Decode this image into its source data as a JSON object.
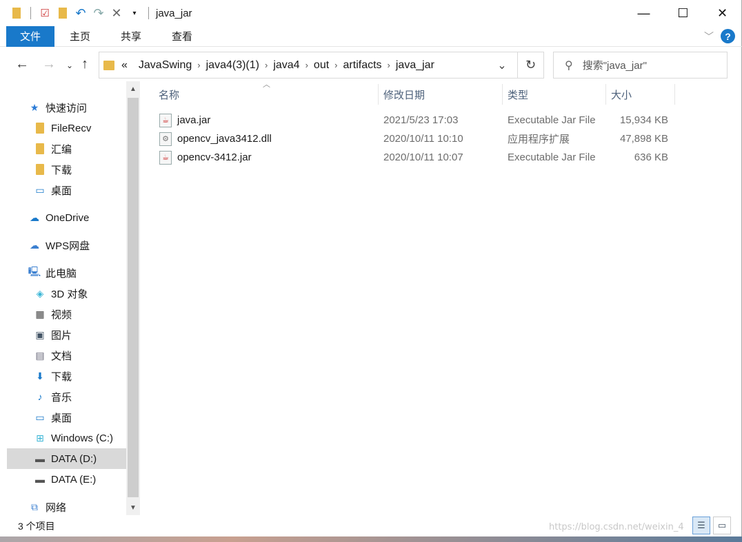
{
  "window": {
    "title": "java_jar"
  },
  "ribbon": {
    "tabs": [
      "文件",
      "主页",
      "共享",
      "查看"
    ],
    "help": "?"
  },
  "address": {
    "overflow": "«",
    "crumbs": [
      "JavaSwing",
      "java4(3)(1)",
      "java4",
      "out",
      "artifacts",
      "java_jar"
    ]
  },
  "search": {
    "placeholder": "搜索\"java_jar\""
  },
  "sidebar": {
    "quick_access": "快速访问",
    "quick_items": [
      "FileRecv",
      "汇编",
      "下载",
      "桌面"
    ],
    "onedrive": "OneDrive",
    "wps": "WPS网盘",
    "this_pc": "此电脑",
    "pc_items": [
      "3D 对象",
      "视频",
      "图片",
      "文档",
      "下载",
      "音乐",
      "桌面",
      "Windows (C:)",
      "DATA (D:)",
      "DATA (E:)"
    ],
    "network": "网络"
  },
  "columns": {
    "name": "名称",
    "date": "修改日期",
    "type": "类型",
    "size": "大小"
  },
  "files": [
    {
      "name": "java.jar",
      "date": "2021/5/23 17:03",
      "type": "Executable Jar File",
      "size": "15,934 KB",
      "icon": "jar-icon"
    },
    {
      "name": "opencv_java3412.dll",
      "date": "2020/10/11 10:10",
      "type": "应用程序扩展",
      "size": "47,898 KB",
      "icon": "dll-icon"
    },
    {
      "name": "opencv-3412.jar",
      "date": "2020/10/11 10:07",
      "type": "Executable Jar File",
      "size": "636 KB",
      "icon": "jar-icon"
    }
  ],
  "status": {
    "item_count": "3 个项目"
  },
  "watermark": "https://blog.csdn.net/weixin_4",
  "colors": {
    "accent": "#1979ca",
    "folder": "#e8b94a",
    "selection": "#d9d9d9"
  }
}
